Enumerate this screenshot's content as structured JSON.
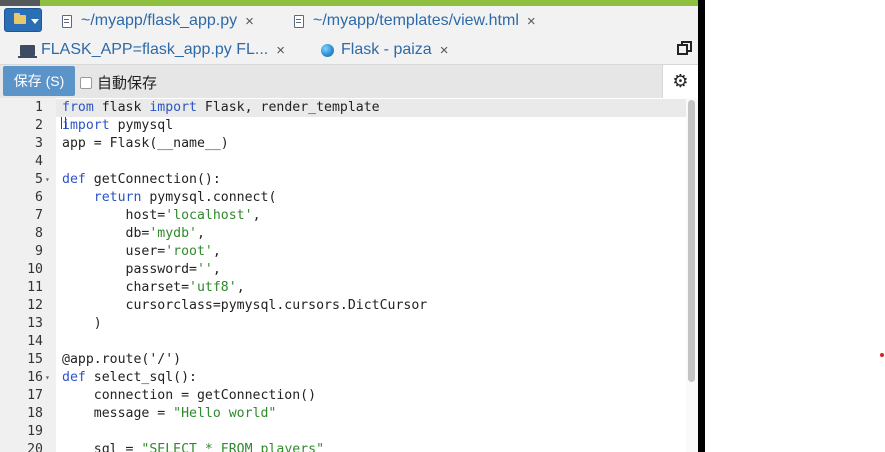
{
  "tabs_row1": [
    {
      "label": "~/myapp/flask_app.py",
      "icon": "file-icon",
      "close": "×"
    },
    {
      "label": "~/myapp/templates/view.html",
      "icon": "file-icon",
      "close": "×"
    }
  ],
  "tabs_row2": [
    {
      "label": "FLASK_APP=flask_app.py FL...",
      "icon": "terminal-icon",
      "close": "×"
    },
    {
      "label": "Flask - paiza",
      "icon": "globe-icon",
      "close": "×"
    }
  ],
  "toolbar": {
    "save_label": "保存 (S)",
    "autosave_label": "自動保存",
    "settings_icon": "⚙"
  },
  "colors": {
    "accent": "#5b94c9",
    "keyword": "#2b54c7",
    "string": "#2f8a2b",
    "top_strip": "#8fbf3f"
  },
  "code_lines": [
    {
      "n": "1",
      "fold": "",
      "parts": [
        [
          "kw",
          "from"
        ],
        [
          "t",
          " flask "
        ],
        [
          "kw",
          "import"
        ],
        [
          "t",
          " Flask, render_template"
        ]
      ]
    },
    {
      "n": "2",
      "fold": "",
      "parts": [
        [
          "kw",
          "import"
        ],
        [
          "t",
          " pymysql"
        ]
      ]
    },
    {
      "n": "3",
      "fold": "",
      "parts": [
        [
          "t",
          "app = Flask(__name__)"
        ]
      ]
    },
    {
      "n": "4",
      "fold": "",
      "parts": []
    },
    {
      "n": "5",
      "fold": "▾",
      "parts": [
        [
          "kw",
          "def"
        ],
        [
          "t",
          " getConnection():"
        ]
      ]
    },
    {
      "n": "6",
      "fold": "",
      "parts": [
        [
          "t",
          "    "
        ],
        [
          "kw",
          "return"
        ],
        [
          "t",
          " pymysql.connect("
        ]
      ]
    },
    {
      "n": "7",
      "fold": "",
      "parts": [
        [
          "t",
          "        host="
        ],
        [
          "str",
          "'localhost'"
        ],
        [
          "t",
          ","
        ]
      ]
    },
    {
      "n": "8",
      "fold": "",
      "parts": [
        [
          "t",
          "        db="
        ],
        [
          "str",
          "'mydb'"
        ],
        [
          "t",
          ","
        ]
      ]
    },
    {
      "n": "9",
      "fold": "",
      "parts": [
        [
          "t",
          "        user="
        ],
        [
          "str",
          "'root'"
        ],
        [
          "t",
          ","
        ]
      ]
    },
    {
      "n": "10",
      "fold": "",
      "parts": [
        [
          "t",
          "        password="
        ],
        [
          "str",
          "''"
        ],
        [
          "t",
          ","
        ]
      ]
    },
    {
      "n": "11",
      "fold": "",
      "parts": [
        [
          "t",
          "        charset="
        ],
        [
          "str",
          "'utf8'"
        ],
        [
          "t",
          ","
        ]
      ]
    },
    {
      "n": "12",
      "fold": "",
      "parts": [
        [
          "t",
          "        cursorclass=pymysql.cursors.DictCursor"
        ]
      ]
    },
    {
      "n": "13",
      "fold": "",
      "parts": [
        [
          "t",
          "    )"
        ]
      ]
    },
    {
      "n": "14",
      "fold": "",
      "parts": []
    },
    {
      "n": "15",
      "fold": "",
      "parts": [
        [
          "t",
          "@app.route('/')"
        ]
      ]
    },
    {
      "n": "16",
      "fold": "▾",
      "parts": [
        [
          "kw",
          "def"
        ],
        [
          "t",
          " select_sql():"
        ]
      ]
    },
    {
      "n": "17",
      "fold": "",
      "parts": [
        [
          "t",
          "    connection = getConnection()"
        ]
      ]
    },
    {
      "n": "18",
      "fold": "",
      "parts": [
        [
          "t",
          "    message = "
        ],
        [
          "str",
          "\"Hello world\""
        ]
      ]
    },
    {
      "n": "19",
      "fold": "",
      "parts": []
    },
    {
      "n": "20",
      "fold": "",
      "parts": [
        [
          "t",
          "    sql = "
        ],
        [
          "str",
          "\"SELECT * FROM players\""
        ]
      ]
    }
  ]
}
